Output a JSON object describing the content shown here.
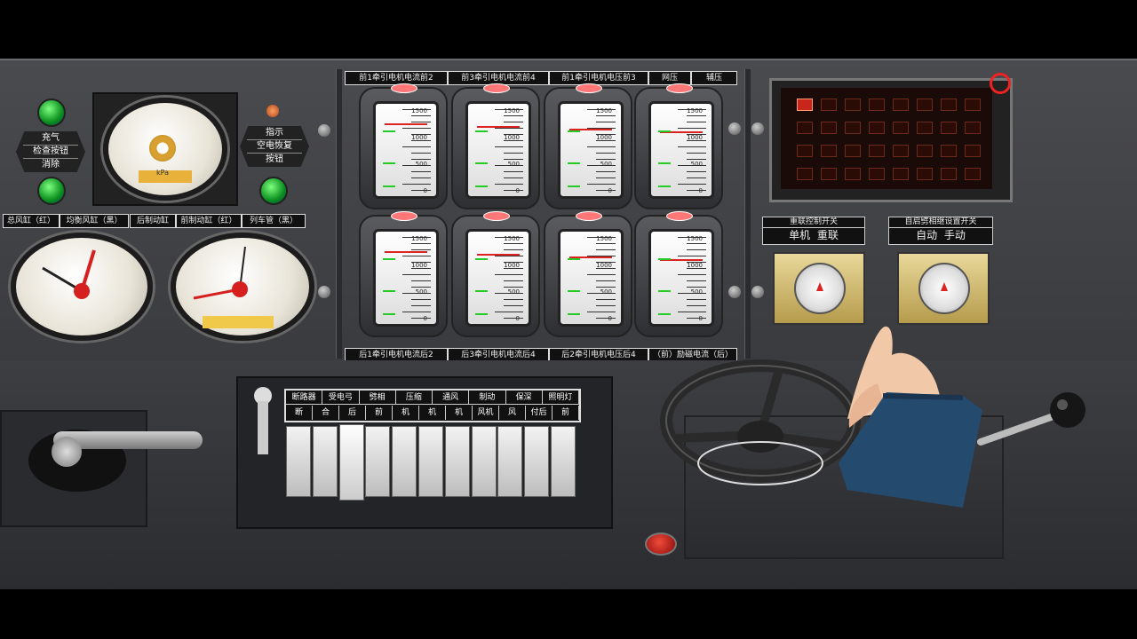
{
  "colors": {
    "panel": "#454649",
    "lamp_green": "#1bbf32",
    "needle_red": "#d62020",
    "led_red": "#c8261a",
    "sleeve_blue": "#244a6e"
  },
  "left_panel": {
    "button_left": {
      "line1": "充气",
      "line2": "检查按钮",
      "line3": "消除"
    },
    "button_right": {
      "line1": "指示",
      "line2": "空电恢复",
      "line3": "按钮"
    },
    "gauge_caption": "kPa",
    "air_labels": [
      "总风缸（红）",
      "均衡风缸（黑）",
      "后制动缸",
      "前制动缸（红）",
      "列车管（黑）"
    ]
  },
  "meters": {
    "top_labels": [
      "前1牵引电机电流前2",
      "前3牵引电机电流前4",
      "前1牵引电机电压前3",
      "网压",
      "辅压"
    ],
    "bottom_labels": [
      "后1牵引电机电流后2",
      "后3牵引电机电流后4",
      "后2牵引电机电压后4",
      "（前）励磁电流（后）"
    ],
    "scale": [
      "1500",
      "1000",
      "500",
      "0"
    ]
  },
  "switches_right": {
    "linkage": {
      "title": "重联控制开关",
      "opt1": "单机",
      "opt2": "重联"
    },
    "phase": {
      "title": "自启劈相继设置开关",
      "opt1": "自动",
      "opt2": "手动"
    }
  },
  "switch_bank": {
    "header_top": [
      "断路器",
      "受电弓",
      "劈相",
      "压缩",
      "通风",
      "制动",
      "保深",
      "照明灯"
    ],
    "header_bottom": [
      "断",
      "合",
      "后",
      "前",
      "机",
      "机",
      "机",
      "风机",
      "风",
      "付后",
      "前"
    ]
  }
}
